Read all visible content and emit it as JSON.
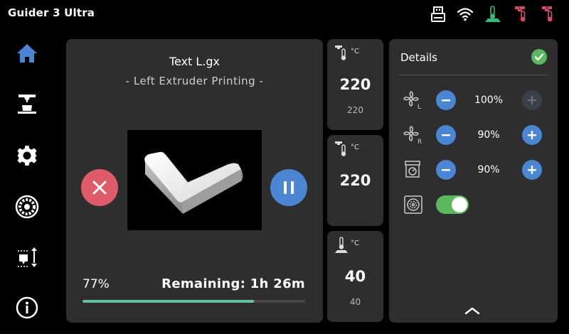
{
  "header": {
    "title": "Guider 3 Ultra",
    "icons": [
      "usb-drive-icon",
      "wifi-icon",
      "bed-temperature-icon",
      "left-extruder-temperature-icon",
      "right-extruder-temperature-icon"
    ]
  },
  "sidebar": {
    "items": [
      {
        "icon": "home-icon",
        "active": true
      },
      {
        "icon": "print-icon",
        "active": false
      },
      {
        "icon": "settings-gear-icon",
        "active": false
      },
      {
        "icon": "filament-spool-icon",
        "active": false
      },
      {
        "icon": "leveling-icon",
        "active": false
      },
      {
        "icon": "info-icon",
        "active": false
      }
    ]
  },
  "print": {
    "file_name": "Text L.gx",
    "status": "- Left Extruder Printing -",
    "progress_label": "77%",
    "progress": 0.77,
    "remaining_label": "Remaining:",
    "remaining_value": "1h 26m"
  },
  "temps": [
    {
      "icon": "left-nozzle-temperature-icon",
      "unit": "°C",
      "current": "220",
      "target": "220"
    },
    {
      "icon": "right-nozzle-temperature-icon",
      "unit": "°C",
      "current": "220",
      "target": ""
    },
    {
      "icon": "bed-temperature-icon",
      "unit": "°C",
      "current": "40",
      "target": "40"
    }
  ],
  "details": {
    "title": "Details",
    "rows": [
      {
        "icon": "left-fan-icon",
        "icon_sub": "L",
        "value": "100%",
        "plus_enabled": false
      },
      {
        "icon": "right-fan-icon",
        "icon_sub": "R",
        "value": "90%",
        "plus_enabled": true
      },
      {
        "icon": "print-speed-icon",
        "value": "90%",
        "plus_enabled": true
      }
    ],
    "toggle": {
      "icon": "filter-fan-icon",
      "on": true
    }
  },
  "colors": {
    "accent_blue": "#4a86d4",
    "cancel_red": "#e05a6a",
    "progress_green": "#66c3a0",
    "toggle_green": "#5cb85c",
    "check_green": "#5cb85c",
    "panel_bg": "#2e2e2e"
  }
}
